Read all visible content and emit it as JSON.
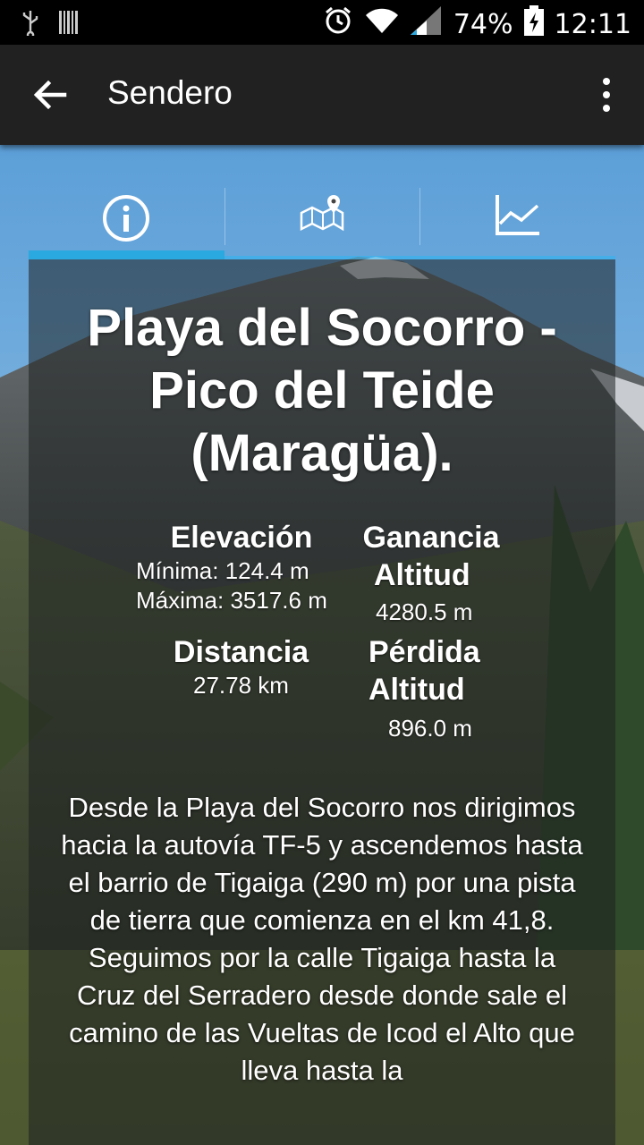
{
  "status_bar": {
    "battery": "74%",
    "time": "12:11",
    "icons": [
      "usb-icon",
      "barcode-icon",
      "alarm-icon",
      "wifi-icon",
      "signal-icon",
      "battery-charging-icon"
    ]
  },
  "app_bar": {
    "title": "Sendero",
    "back_icon": "arrow-back-icon",
    "menu_icon": "more-vert-icon"
  },
  "tabs": [
    {
      "icon": "info-icon",
      "active": true
    },
    {
      "icon": "map-pin-icon",
      "active": false
    },
    {
      "icon": "line-chart-icon",
      "active": false
    }
  ],
  "trail": {
    "title": "Playa del Socorro - Pico del Teide (Maragüa).",
    "elevation": {
      "label": "Elevación",
      "min": "Mínima: 124.4 m",
      "max": "Máxima: 3517.6 m"
    },
    "gain": {
      "label_line1": "Ganancia",
      "label_line2": "Altitud",
      "value": "4280.5 m"
    },
    "distance": {
      "label": "Distancia",
      "value": "27.78 km"
    },
    "loss": {
      "label_line1": "Pérdida",
      "label_line2": "Altitud",
      "value": "896.0 m"
    },
    "description": "Desde la Playa del Socorro nos dirigimos hacia la autovía TF-5 y ascendemos hasta el barrio de Tigaiga (290 m) por una pista de tierra que comienza en el km 41,8. Seguimos por la calle Tigaiga hasta la Cruz del Serradero desde donde sale el camino de las Vueltas de Icod el Alto que lleva hasta la"
  },
  "colors": {
    "accent": "#2aa9e0",
    "app_bar": "#212121",
    "status_bar": "#000000"
  }
}
